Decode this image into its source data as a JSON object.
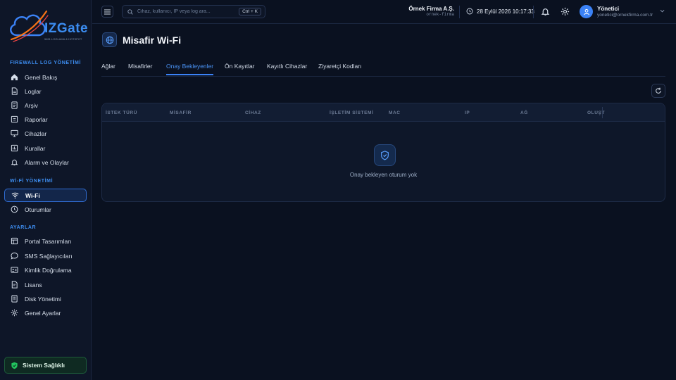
{
  "brand": {
    "name": "IZGate",
    "tagline": "5651 LOGLAMA & HOTSPOT",
    "accent": "#3b82f6"
  },
  "sidebar": {
    "sections": [
      {
        "label": "FIREWALL LOG YÖNETİMİ",
        "items": [
          {
            "label": "Genel Bakış",
            "icon": "home-icon"
          },
          {
            "label": "Loglar",
            "icon": "file-icon"
          },
          {
            "label": "Arşiv",
            "icon": "archive-icon"
          },
          {
            "label": "Raporlar",
            "icon": "report-icon"
          },
          {
            "label": "Cihazlar",
            "icon": "monitor-icon"
          },
          {
            "label": "Kurallar",
            "icon": "rules-icon"
          },
          {
            "label": "Alarm ve Olaylar",
            "icon": "bell-icon"
          }
        ]
      },
      {
        "label": "Wİ-Fİ YÖNETİMİ",
        "items": [
          {
            "label": "Wi-Fi",
            "icon": "wifi-icon",
            "active": true
          },
          {
            "label": "Oturumlar",
            "icon": "clock-icon"
          }
        ]
      },
      {
        "label": "AYARLAR",
        "items": [
          {
            "label": "Portal Tasarımları",
            "icon": "layout-icon"
          },
          {
            "label": "SMS Sağlayıcıları",
            "icon": "message-icon"
          },
          {
            "label": "Kimlik Doğrulama",
            "icon": "id-card-icon"
          },
          {
            "label": "Lisans",
            "icon": "license-icon"
          },
          {
            "label": "Disk Yönetimi",
            "icon": "disk-icon"
          },
          {
            "label": "Genel Ayarlar",
            "icon": "gear-icon"
          }
        ]
      }
    ],
    "health_label": "Sistem Sağlıklı"
  },
  "header": {
    "search_placeholder": "Cihaz, kullanıcı, IP veya log ara...",
    "search_shortcut": "Ctrl + K",
    "company_name": "Örnek Firma A.Ş.",
    "company_slug": "ornek-firma",
    "datetime": "28 Eylül 2026 10:17:33",
    "user_name": "Yönetici",
    "user_email": "yonetici@ornekfirma.com.tr"
  },
  "page": {
    "title": "Misafir Wi-Fi",
    "tabs": [
      "Ağlar",
      "Misafirler",
      "Onay Bekleyenler",
      "Ön Kayıtlar",
      "Kayıtlı Cihazlar",
      "Ziyaretçi Kodları"
    ],
    "active_tab": "Onay Bekleyenler"
  },
  "table": {
    "columns": [
      "İSTEK TÜRÜ",
      "MİSAFİR",
      "CİHAZ",
      "İŞLETİM SİSTEMİ",
      "MAC",
      "IP",
      "AĞ",
      "OLUŞT"
    ],
    "rows": [],
    "empty_message": "Onay bekleyen oturum yok"
  }
}
